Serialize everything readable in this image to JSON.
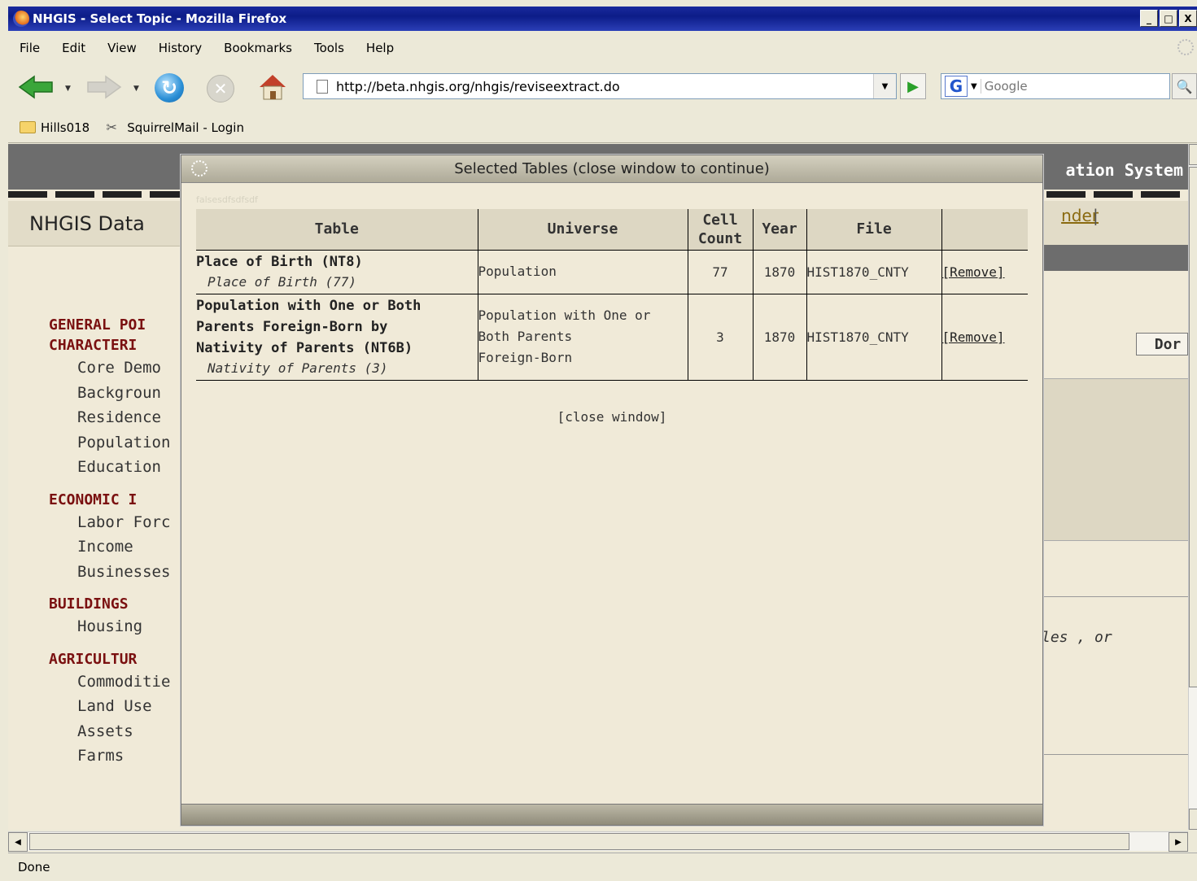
{
  "window": {
    "title": "NHGIS - Select Topic - Mozilla Firefox",
    "controls": [
      "_",
      "□",
      "X"
    ]
  },
  "menu": {
    "file": "File",
    "edit": "Edit",
    "view": "View",
    "history": "History",
    "bookmarks": "Bookmarks",
    "tools": "Tools",
    "help": "Help"
  },
  "toolbar": {
    "url": "http://beta.nhgis.org/nhgis/reviseextract.do",
    "search_placeholder": "Google"
  },
  "bookmarks_bar": {
    "folder": "Hills018",
    "link": "SquirrelMail - Login"
  },
  "site": {
    "brand": "ation System",
    "page_heading": "NHGIS Data",
    "header_link": "nder",
    "header_sep": "|",
    "done_button": "Dor",
    "side_text": "les , or"
  },
  "nav": {
    "groups": [
      {
        "title_lines": [
          "GENERAL POI",
          "CHARACTERI"
        ],
        "items": [
          "Core Demo",
          "Backgroun",
          "Residence",
          "Population",
          "Education"
        ]
      },
      {
        "title_lines": [
          "ECONOMIC I"
        ],
        "items": [
          "Labor Forc",
          "Income",
          "Businesses"
        ]
      },
      {
        "title_lines": [
          "BUILDINGS"
        ],
        "items": [
          "Housing"
        ]
      },
      {
        "title_lines": [
          "AGRICULTUR"
        ],
        "items": [
          "Commoditie",
          "Land Use",
          "Assets",
          "Farms"
        ]
      }
    ]
  },
  "modal": {
    "title": "Selected Tables (close window to continue)",
    "ghost_text": "falsesdfsdfsdf",
    "columns": {
      "table": "Table",
      "universe": "Universe",
      "cell_count_line1": "Cell",
      "cell_count_line2": "Count",
      "year": "Year",
      "file": "File"
    },
    "rows": [
      {
        "name_lines": [
          "Place of Birth (NT8)"
        ],
        "sub": "Place of Birth (77)",
        "universe_lines": [
          "Population"
        ],
        "cell_count": "77",
        "year": "1870",
        "file": "HIST1870_CNTY",
        "action": "[Remove]"
      },
      {
        "name_lines": [
          "Population with One or Both",
          "Parents Foreign-Born by",
          "Nativity of Parents (NT6B)"
        ],
        "sub": "Nativity of Parents (3)",
        "universe_lines": [
          "Population with One or",
          "Both Parents",
          "Foreign-Born"
        ],
        "cell_count": "3",
        "year": "1870",
        "file": "HIST1870_CNTY",
        "action": "[Remove]"
      }
    ],
    "close_link": "[close window]"
  },
  "status": {
    "text": "Done"
  }
}
